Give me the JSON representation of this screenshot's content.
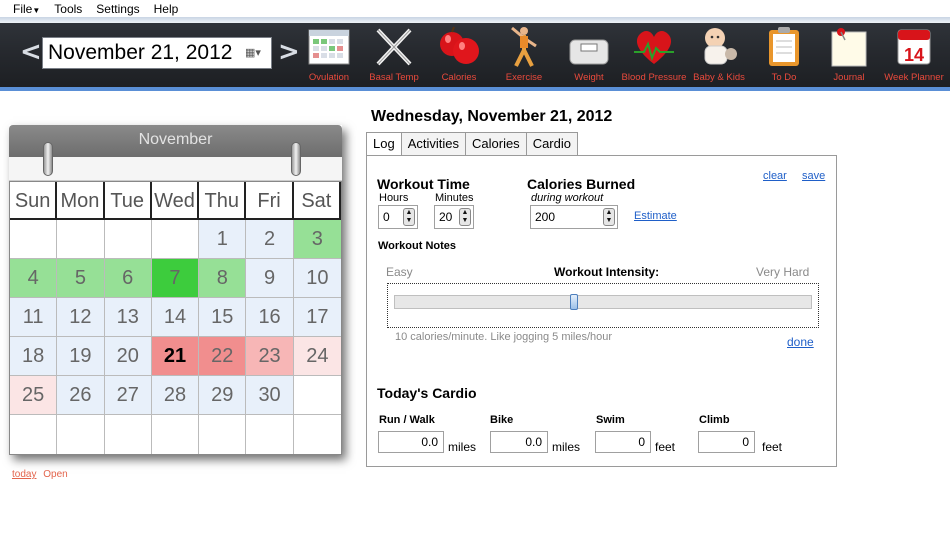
{
  "menu": [
    "File",
    "Tools",
    "Settings",
    "Help"
  ],
  "toolbar": {
    "date_value": "November 21, 2012",
    "tools": [
      {
        "label": "Ovulation",
        "icon": "calendar-grid-icon"
      },
      {
        "label": "Basal Temp",
        "icon": "thermometers-icon"
      },
      {
        "label": "Calories",
        "icon": "apple-icon"
      },
      {
        "label": "Exercise",
        "icon": "stretching-person-icon"
      },
      {
        "label": "Weight",
        "icon": "scale-icon"
      },
      {
        "label": "Blood Pressure",
        "icon": "heart-pulse-icon"
      },
      {
        "label": "Baby & Kids",
        "icon": "baby-icon"
      },
      {
        "label": "To Do",
        "icon": "clipboard-icon"
      },
      {
        "label": "Journal",
        "icon": "notepad-pin-icon"
      },
      {
        "label": "Week Planner",
        "icon": "calendar-14-icon"
      }
    ],
    "calendar_icon_day": "14"
  },
  "calendar": {
    "month": "November",
    "weekdays": [
      "Sun",
      "Mon",
      "Tue",
      "Wed",
      "Thu",
      "Fri",
      "Sat"
    ],
    "weeks": [
      [
        "",
        "",
        "",
        "",
        "1",
        "2",
        "3"
      ],
      [
        "4",
        "5",
        "6",
        "7",
        "8",
        "9",
        "10"
      ],
      [
        "11",
        "12",
        "13",
        "14",
        "15",
        "16",
        "17"
      ],
      [
        "18",
        "19",
        "20",
        "21",
        "22",
        "23",
        "24"
      ],
      [
        "25",
        "26",
        "27",
        "28",
        "29",
        "30",
        ""
      ],
      [
        "",
        "",
        "",
        "",
        "",
        "",
        ""
      ]
    ],
    "today_label": "today",
    "open_label": "Open",
    "colors": {
      "light_blue": "#e8f0fa",
      "green": "#96e096",
      "bright_green": "#3dcc3d",
      "red": "#f18e8e",
      "pink": "#f7b6b6",
      "light_pink": "#fbe5e5"
    }
  },
  "day_title": "Wednesday, November 21, 2012",
  "tabs": [
    "Log",
    "Activities",
    "Calories",
    "Cardio"
  ],
  "log": {
    "workout_time_title": "Workout Time",
    "hours_label": "Hours",
    "minutes_label": "Minutes",
    "hours_value": "0",
    "minutes_value": "20",
    "calories_title": "Calories Burned",
    "during_workout": "during workout",
    "calories_value": "200",
    "estimate_link": "Estimate",
    "clear_link": "clear",
    "save_link": "save",
    "workout_notes": "Workout Notes",
    "easy": "Easy",
    "intensity": "Workout Intensity:",
    "very_hard": "Very Hard",
    "intensity_level": 0.43,
    "intensity_desc": "10 calories/minute. Like jogging 5 miles/hour",
    "done_link": "done"
  },
  "cardio": {
    "title": "Today's Cardio",
    "items": [
      {
        "label": "Run / Walk",
        "value": "0.0",
        "unit": "miles"
      },
      {
        "label": "Bike",
        "value": "0.0",
        "unit": "miles"
      },
      {
        "label": "Swim",
        "value": "0",
        "unit": "feet"
      },
      {
        "label": "Climb",
        "value": "0",
        "unit": "feet"
      }
    ]
  }
}
